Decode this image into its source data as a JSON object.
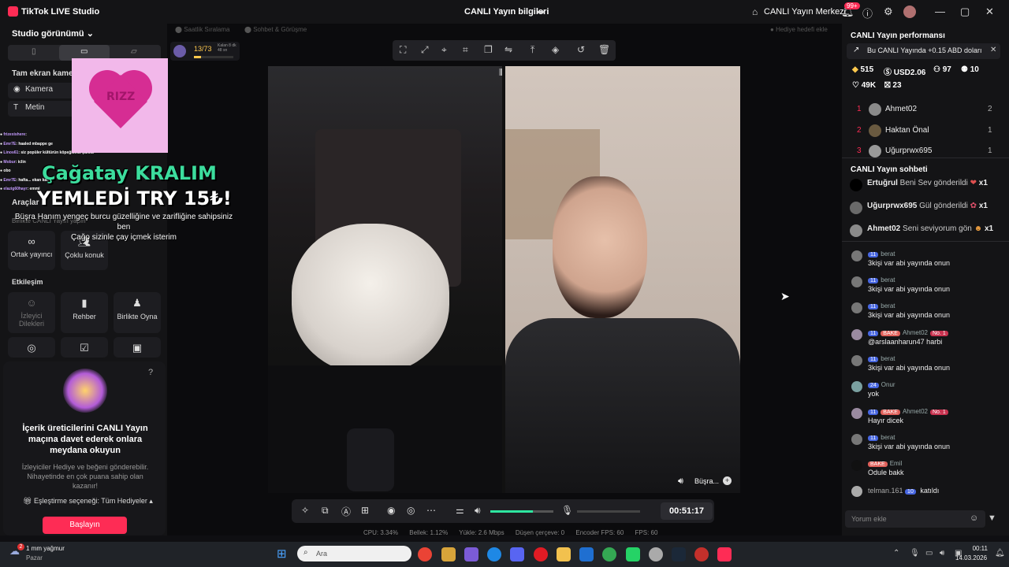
{
  "titlebar": {
    "app_name": "TikTok LIVE Studio",
    "center_title": "CANLI Yayın bilgileri",
    "live_center": "CANLI Yayın Merkezi",
    "notif_count": "99+"
  },
  "left": {
    "studio_view": "Studio görünümü",
    "fullscreen_camera": "Tam ekran kamera",
    "camera_label": "Kamera",
    "text_label": "Metin",
    "tools_heading": "Araçlar",
    "together_heading": "Birlikte CANLI Yayın yapın",
    "cohost": "Ortak yayıncı",
    "multi_guest": "Çoklu konuk",
    "interaction_heading": "Etkileşim",
    "viewer_wishes": "İzleyici Dilekleri",
    "guide": "Rehber",
    "play_together": "Birlikte Oyna",
    "invite_title": "İçerik üreticilerini CANLI Yayın maçına davet ederek onlara meydana okuyun",
    "invite_desc": "İzleyiciler Hediye ve beğeni gönderebilir. Nihayetinde en çok puana sahip olan kazanır!",
    "match_option": "Eşleştirme seçeneği: Tüm Hediyeler",
    "start_button": "Başlayın"
  },
  "overlay": {
    "mini_chat": [
      {
        "user": "frizexishere",
        "text": ":"
      },
      {
        "user": "Emr7E",
        "text": ": haaled mbappe ge"
      },
      {
        "user": "Linos61",
        "text": ": siz popüler kültürün köpeğisiniz çünkü"
      },
      {
        "user": "Mobur",
        "text": ": iclin"
      },
      {
        "user": "",
        "text": "obo"
      },
      {
        "user": "Emr7E",
        "text": ": hafta... ekan kaç"
      },
      {
        "user": "elazig60hayr",
        "text": ": emmi"
      }
    ],
    "heart_text": "RIZZ",
    "donor_line": "Çağatay KRALIM",
    "gift_line": "YEMLEDİ TRY 15₺!",
    "message_line1": "Büşra Hanım yengeç burcu güzelliğine ve zarifliğine sahipsiniz ben",
    "message_line2": "Çağo sizinle çay içmek isterim",
    "progress_text": "13/73",
    "progress_sub": "Kalan 8 dk 48 sn",
    "progress": 0.18,
    "hourly_rank": "Saatlik Sıralama",
    "chat_friends": "Sohbet & Görüşme",
    "gift_goal": "Hediye hedefi ekle"
  },
  "video": {
    "right_label": "Büşra...",
    "timer": "00:51:17"
  },
  "stats": {
    "cpu": "CPU: 3.34%",
    "mem": "Bellek: 1.12%",
    "upload": "Yükle: 2.6 Mbps",
    "dropped": "Düşen çerçeve: 0",
    "encoder": "Encoder FPS: 60",
    "fps": "FPS: 60"
  },
  "right": {
    "perf_title": "CANLI Yayın performansı",
    "notif_text": "Bu CANLI Yayında +0.15 ABD doları",
    "coins": "515",
    "usd": "USD2.06",
    "viewers": "97",
    "followers": "10",
    "likes": "49K",
    "gifts": "23",
    "ranking": [
      {
        "rank": "1",
        "name": "Ahmet02",
        "value": "2"
      },
      {
        "rank": "2",
        "name": "Haktan Önal",
        "value": "1"
      },
      {
        "rank": "3",
        "name": "Uğurprwx695",
        "value": "1"
      }
    ],
    "chat_title": "CANLI Yayın sohbeti",
    "gift_msgs": [
      {
        "name": "Ertuğrul",
        "action": "Beni Sev gönderildi",
        "count": "x1"
      },
      {
        "name": "Uğurprwx695",
        "action": "Gül gönderildi",
        "count": "x1"
      },
      {
        "name": "Ahmet02",
        "action": "Seni seviyorum gön",
        "count": "x1"
      }
    ],
    "chat": [
      {
        "level": "11",
        "name": "berat",
        "text": "3kişi var abi yayında onun"
      },
      {
        "level": "11",
        "name": "berat",
        "text": "3kişi var abi yayında onun"
      },
      {
        "level": "11",
        "name": "berat",
        "text": "3kişi var abi yayında onun"
      },
      {
        "level": "11",
        "fan": "BAKE",
        "name": "Ahmet02",
        "rank": "No. 1",
        "text": "@arslaanharun47 harbi"
      },
      {
        "level": "11",
        "name": "berat",
        "text": "3kişi var abi yayında onun"
      },
      {
        "level": "24",
        "name": "Onur",
        "text": "yok"
      },
      {
        "level": "11",
        "fan": "BAKE",
        "name": "Ahmet02",
        "rank": "No. 1",
        "text": "Hayır dicek"
      },
      {
        "level": "11",
        "name": "berat",
        "text": "3kişi var abi yayında onun"
      },
      {
        "fan": "BAKE",
        "name": "Emil",
        "text": "Odule bakk"
      }
    ],
    "joined": {
      "name": "telman.161",
      "level": "10",
      "text": "katıldı"
    },
    "comment_placeholder": "Yorum ekle"
  },
  "taskbar": {
    "weather_temp": "1 mm yağmur",
    "weather_day": "Pazar",
    "weather_badge": "2",
    "search_placeholder": "Ara",
    "time": "00:11",
    "date": "14.03.2026"
  },
  "colors": {
    "accent": "#fe2c55",
    "bg": "#0f0f12",
    "panel": "#141416"
  }
}
